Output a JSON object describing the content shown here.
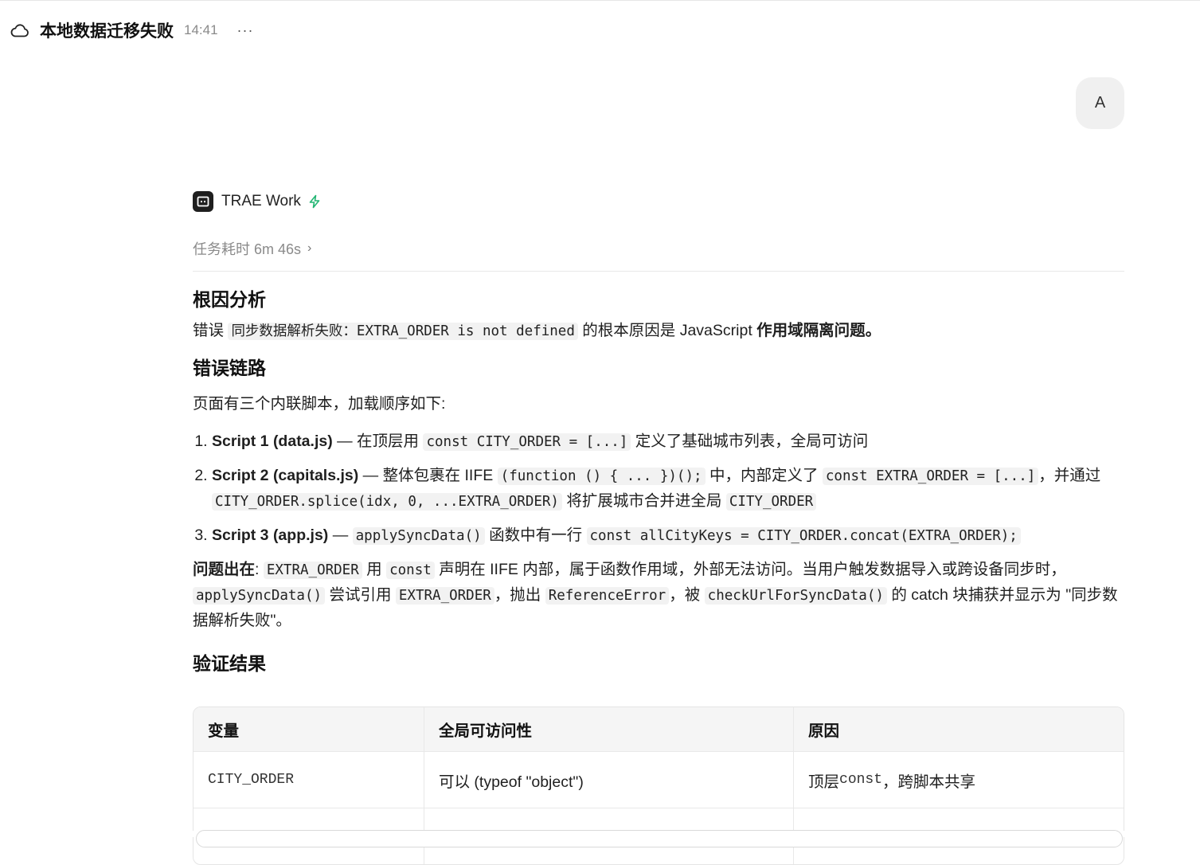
{
  "header": {
    "title": "本地数据迁移失败",
    "time": "14:41",
    "more": "···"
  },
  "user": {
    "avatar": "A"
  },
  "agent": {
    "name": "TRAE Work",
    "duration": "任务耗时 6m 46s",
    "chevron": "›"
  },
  "content": {
    "h_root": "根因分析",
    "p1_pre": "错误",
    "p1_code": "同步数据解析失败：EXTRA_ORDER is not defined",
    "p1_mid": "的根本原因是 JavaScript ",
    "p1_bold": "作用域隔离问题",
    "p1_end": "。",
    "h_chain": "错误链路",
    "p2": "页面有三个内联脚本，加载顺序如下:",
    "li1_bold": "Script 1 (data.js)",
    "li1_a": " — 在顶层用 ",
    "li1_code": "const CITY_ORDER = [...]",
    "li1_b": " 定义了基础城市列表，全局可访问",
    "li2_bold": "Script 2 (capitals.js)",
    "li2_a": " — 整体包裹在 IIFE ",
    "li2_code1": "(function () { ... })();",
    "li2_b": " 中，内部定义了 ",
    "li2_code2": "const EXTRA_ORDER = [...]",
    "li2_c": "，并通过 ",
    "li2_code3": "CITY_ORDER.splice(idx, 0, ...EXTRA_ORDER)",
    "li2_d": " 将扩展城市合并进全局 ",
    "li2_code4": "CITY_ORDER",
    "li3_bold": "Script 3 (app.js)",
    "li3_a": " — ",
    "li3_code1": "applySyncData()",
    "li3_b": " 函数中有一行 ",
    "li3_code2": "const allCityKeys = CITY_ORDER.concat(EXTRA_ORDER);",
    "p3_bold": "问题出在",
    "p3_a": ": ",
    "p3_code1": "EXTRA_ORDER",
    "p3_b": " 用 ",
    "p3_code2": "const",
    "p3_c": " 声明在 IIFE 内部，属于函数作用域，外部无法访问。当用户触发数据导入或跨设备同步时，",
    "p3_code3": "applySyncData()",
    "p3_d": " 尝试引用 ",
    "p3_code4": "EXTRA_ORDER",
    "p3_e": "，抛出 ",
    "p3_code5": "ReferenceError",
    "p3_f": "，被 ",
    "p3_code6": "checkUrlForSyncData()",
    "p3_g": " 的 catch 块捕获并显示为 \"同步数据解析失败\"。",
    "h_verify": "验证结果"
  },
  "table": {
    "headers": [
      "变量",
      "全局可访问性",
      "原因"
    ],
    "rows": [
      {
        "var": "CITY_ORDER",
        "access": "可以 (typeof \"object\")",
        "reason_pre": "顶层 ",
        "reason_code": "const",
        "reason_post": "，跨脚本共享"
      }
    ]
  },
  "colors": {
    "accent_bolt": "#22b573",
    "code_bg": "#f2f2f2"
  }
}
